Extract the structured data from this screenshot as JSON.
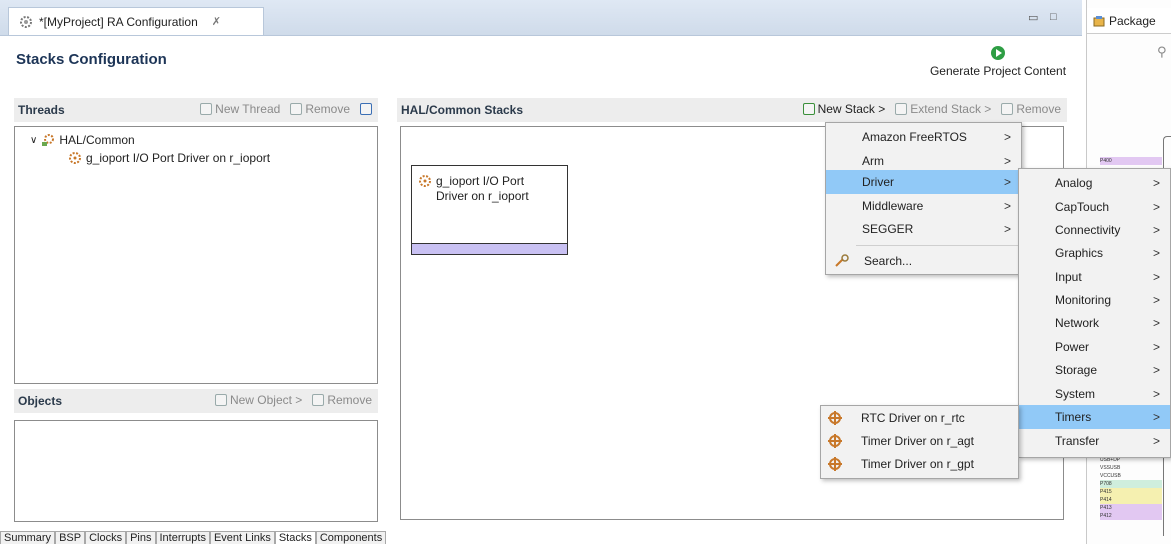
{
  "editor_tab": {
    "title": "*[MyProject] RA Configuration",
    "close": "✗"
  },
  "right_tab": {
    "title": "Package",
    "close": "✗"
  },
  "form": {
    "title": "Stacks Configuration",
    "generate_label": "Generate Project Content"
  },
  "threads": {
    "header": "Threads",
    "new_thread": "New Thread",
    "remove": "Remove",
    "root": "HAL/Common",
    "child": "g_ioport I/O Port Driver on r_ioport"
  },
  "objects": {
    "header": "Objects",
    "new_object": "New Object >",
    "remove": "Remove"
  },
  "hal_stacks": {
    "header": "HAL/Common Stacks",
    "new_stack": "New Stack >",
    "extend_stack": "Extend Stack >",
    "remove": "Remove",
    "module_line1": "g_ioport I/O Port",
    "module_line2": "Driver on r_ioport"
  },
  "menu1": {
    "items": [
      "Amazon FreeRTOS",
      "Arm",
      "Driver",
      "Middleware",
      "SEGGER"
    ],
    "search": "Search...",
    "highlighted": "Driver"
  },
  "menu2": {
    "items": [
      "Analog",
      "CapTouch",
      "Connectivity",
      "Graphics",
      "Input",
      "Monitoring",
      "Network",
      "Power",
      "Storage",
      "System",
      "Timers",
      "Transfer"
    ],
    "highlighted": "Timers"
  },
  "menu3": {
    "items": [
      "RTC Driver on r_rtc",
      "Timer Driver on r_agt",
      "Timer Driver on r_gpt"
    ]
  },
  "bottom_tabs": [
    "Summary",
    "BSP",
    "Clocks",
    "Pins",
    "Interrupts",
    "Event Links",
    "Stacks",
    "Components"
  ],
  "pins": [
    "P400",
    "USB+DP",
    "VSSUSB",
    "VCCUSB",
    "P708",
    "P415",
    "P414",
    "P413",
    "P412"
  ],
  "colors": {
    "highlight": "#91c9f7",
    "module_bar": "#c9c1f3",
    "accent": "#2e9e44"
  }
}
